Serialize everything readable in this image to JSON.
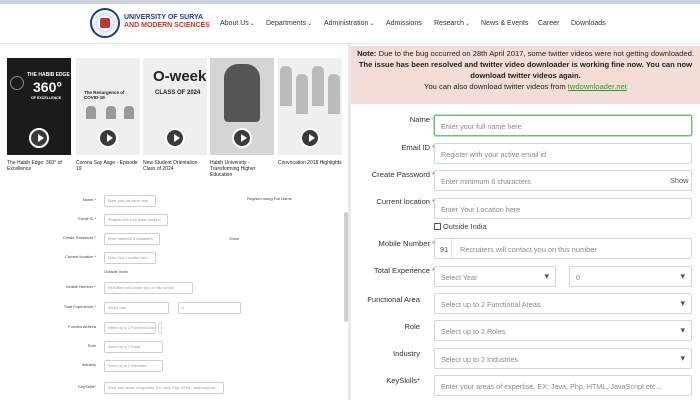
{
  "header": {
    "brand_line1": "UNIVERSITY OF SURYA",
    "brand_line2": "AND MODERN SCIENCES",
    "nav": [
      {
        "label": "About Us",
        "dropdown": true
      },
      {
        "label": "Departments",
        "dropdown": true
      },
      {
        "label": "Administration",
        "dropdown": true
      },
      {
        "label": "Admissions",
        "dropdown": false
      },
      {
        "label": "Research",
        "dropdown": true
      },
      {
        "label": "News & Events",
        "dropdown": false
      },
      {
        "label": "Career",
        "dropdown": false
      },
      {
        "label": "Downloads",
        "dropdown": false
      }
    ],
    "chevron": "⌄"
  },
  "videos": [
    {
      "caption": "The Habib Edge: 360° of Excellence",
      "overlay1": "THE HABIB EDGE",
      "overlay2": "360°",
      "overlay3": "OF EXCELLENCE"
    },
    {
      "caption": "Corona Say Aage - Episode 19",
      "overlay1": "The Resurgence of COVID-19",
      "overlay2": "",
      "overlay3": ""
    },
    {
      "caption": "New Student Orientation Class of 2024",
      "overlay1": "O-week",
      "overlay2": "CLASS OF 2024",
      "overlay3": ""
    },
    {
      "caption": "Habib University - Transforming Higher Education",
      "overlay1": "",
      "overlay2": "",
      "overlay3": ""
    },
    {
      "caption": "Convocation 2018 Highlights",
      "overlay1": "",
      "overlay2": "",
      "overlay3": ""
    }
  ],
  "mini_form": {
    "name_label": "Name *",
    "name_ph": "Enter your full name here",
    "note": "Register using Full Name",
    "email_label": "Email ID *",
    "email_ph": "Register with your active email id",
    "pwd_label": "Create Password *",
    "pwd_ph": "Enter minimum 6 characters",
    "show": "Show",
    "loc_label": "Current location *",
    "loc_ph": "Enter Your Location here",
    "outside": "Outside India",
    "mobile_label": "Mobile Number *",
    "mobile_ph": "Recruiters will contact you on this number",
    "exp_label": "Total Experience *",
    "exp_year": "Select Year",
    "exp_month": "0",
    "func_label": "Functional Area",
    "func_ph": "Select up to 2 Functional Areas",
    "role_label": "Role",
    "role_ph": "Select up to 2 Roles",
    "ind_label": "Industry",
    "ind_ph": "Select up to 2 Industries",
    "skills_label": "KeySkills*",
    "skills_ph": "Enter your areas of expertise. EX: Java, Php, HTML, JavaScript etc..."
  },
  "notice": {
    "note_prefix": "Note:",
    "line1": "Due to the bug occurred on 28th April 2017, some twitter videos were not getting downloaded.",
    "line2": "The issue has been resolved and twitter video downloader is working fine now. You can now download twitter videos again.",
    "line3_text": "You can also download twitter videos from",
    "line3_link": "twdownloader.net"
  },
  "form": {
    "name": {
      "label": "Name",
      "placeholder": "Enter your full name here"
    },
    "email": {
      "label": "Email ID",
      "placeholder": "Register with your active email id"
    },
    "password": {
      "label": "Create Password",
      "placeholder": "Enter minimum 6 characters",
      "show": "Show"
    },
    "location": {
      "label": "Current location",
      "placeholder": "Enter Your Location here",
      "outside": "Outside India"
    },
    "mobile": {
      "label": "Mobile Number",
      "code": "91",
      "placeholder": "Recruiters will contact you on this number"
    },
    "experience": {
      "label": "Total Experience",
      "year": "Select Year",
      "month": "0"
    },
    "functional": {
      "label": "Functional Area",
      "placeholder": "Select up to 2 Functional Areas"
    },
    "role": {
      "label": "Role",
      "placeholder": "Select up to 2 Roles"
    },
    "industry": {
      "label": "Industry",
      "placeholder": "Select up to 2 Industries"
    },
    "skills": {
      "label": "KeySkills",
      "placeholder": "Enter your areas of expertise. EX: Java, Php, HTML, JavaScript etc..."
    },
    "required_mark": "*"
  }
}
